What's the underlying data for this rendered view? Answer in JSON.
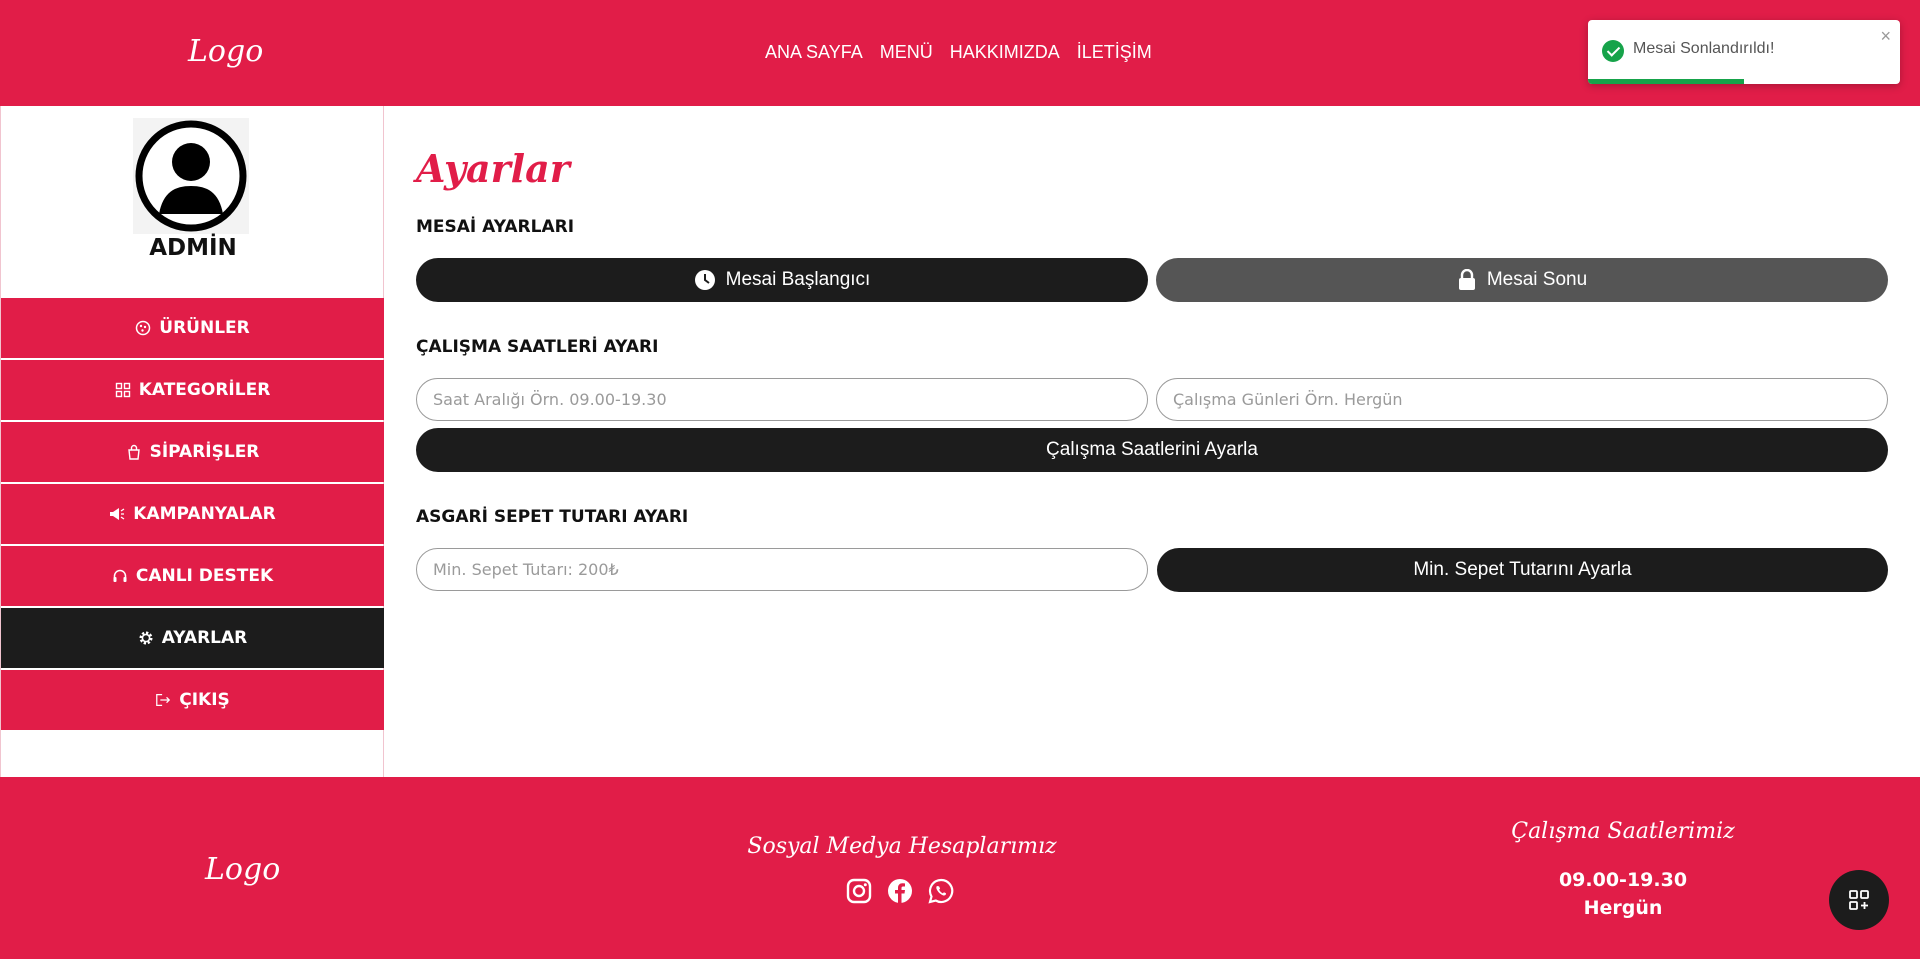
{
  "header": {
    "logo": "Logo",
    "nav": [
      "ANA SAYFA",
      "MENÜ",
      "HAKKIMIZDA",
      "İLETİŞİM"
    ]
  },
  "toast": {
    "message": "Mesai Sonlandırıldı!",
    "close": "×",
    "progress_fraction": 0.5,
    "color": "#16a34a"
  },
  "sidebar": {
    "admin_name": "ADMİN",
    "items": [
      {
        "label": "ÜRÜNLER",
        "icon": "pizza-icon"
      },
      {
        "label": "KATEGORİLER",
        "icon": "grid-icon"
      },
      {
        "label": "SİPARİŞLER",
        "icon": "shopping-bag-icon"
      },
      {
        "label": "KAMPANYALAR",
        "icon": "megaphone-icon"
      },
      {
        "label": "CANLI DESTEK",
        "icon": "headset-icon"
      },
      {
        "label": "AYARLAR",
        "icon": "gear-icon",
        "active": true
      },
      {
        "label": "ÇIKIŞ",
        "icon": "logout-icon"
      }
    ]
  },
  "main": {
    "title": "Ayarlar",
    "shift": {
      "title": "MESAİ AYARLARI",
      "start_label": "Mesai Başlangıcı",
      "end_label": "Mesai Sonu"
    },
    "hours": {
      "title": "ÇALIŞMA SAATLERİ AYARI",
      "range_placeholder": "Saat Aralığı Örn. 09.00-19.30",
      "days_placeholder": "Çalışma Günleri Örn. Hergün",
      "submit_label": "Çalışma Saatlerini Ayarla"
    },
    "basket": {
      "title": "ASGARİ SEPET TUTARI AYARI",
      "min_placeholder": "Min. Sepet Tutarı: 200₺",
      "submit_label": "Min. Sepet Tutarını Ayarla"
    }
  },
  "footer": {
    "logo": "Logo",
    "social_title": "Sosyal Medya Hesaplarımız",
    "social_icons": [
      "instagram-icon",
      "facebook-icon",
      "whatsapp-icon"
    ],
    "hours_title": "Çalışma Saatlerimiz",
    "hours": "09.00-19.30",
    "days": "Hergün"
  },
  "colors": {
    "brand": "#e11d48",
    "dark": "#1c1c1c",
    "gray_button": "#555555"
  }
}
